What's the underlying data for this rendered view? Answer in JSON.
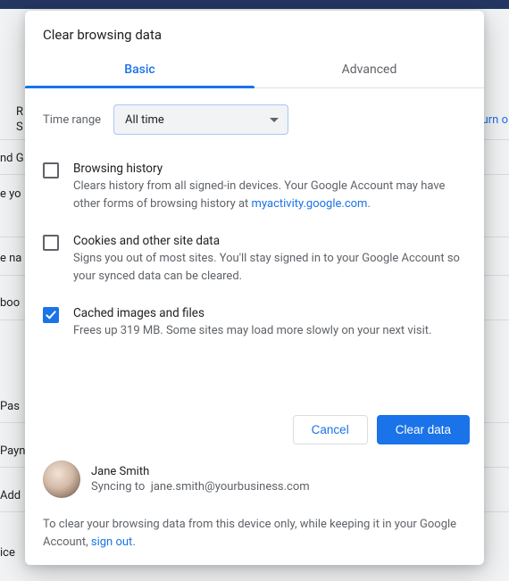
{
  "background": {
    "turnOn": "Turn o",
    "items": [
      "R",
      "S",
      "nd G",
      "e yo",
      "e na",
      "boo",
      "Pas",
      "Payn",
      "Add",
      "ice"
    ]
  },
  "dialog": {
    "title": "Clear browsing data",
    "tabs": {
      "basic": "Basic",
      "advanced": "Advanced"
    },
    "timeRange": {
      "label": "Time range",
      "value": "All time"
    },
    "options": [
      {
        "title": "Browsing history",
        "descPrefix": "Clears history from all signed-in devices. Your Google Account may have other forms of browsing history at ",
        "link": "myactivity.google.com",
        "descSuffix": ".",
        "checked": false
      },
      {
        "title": "Cookies and other site data",
        "desc": "Signs you out of most sites. You'll stay signed in to your Google Account so your synced data can be cleared.",
        "checked": false
      },
      {
        "title": "Cached images and files",
        "desc": "Frees up 319 MB. Some sites may load more slowly on your next visit.",
        "checked": true
      }
    ],
    "buttons": {
      "cancel": "Cancel",
      "clear": "Clear data"
    },
    "user": {
      "name": "Jane Smith",
      "syncLabel": "Syncing to",
      "email": "jane.smith@yourbusiness.com"
    },
    "footer": {
      "prefix": "To clear your browsing data from this device only, while keeping it in your Google Account, ",
      "link": "sign out",
      "suffix": "."
    }
  }
}
